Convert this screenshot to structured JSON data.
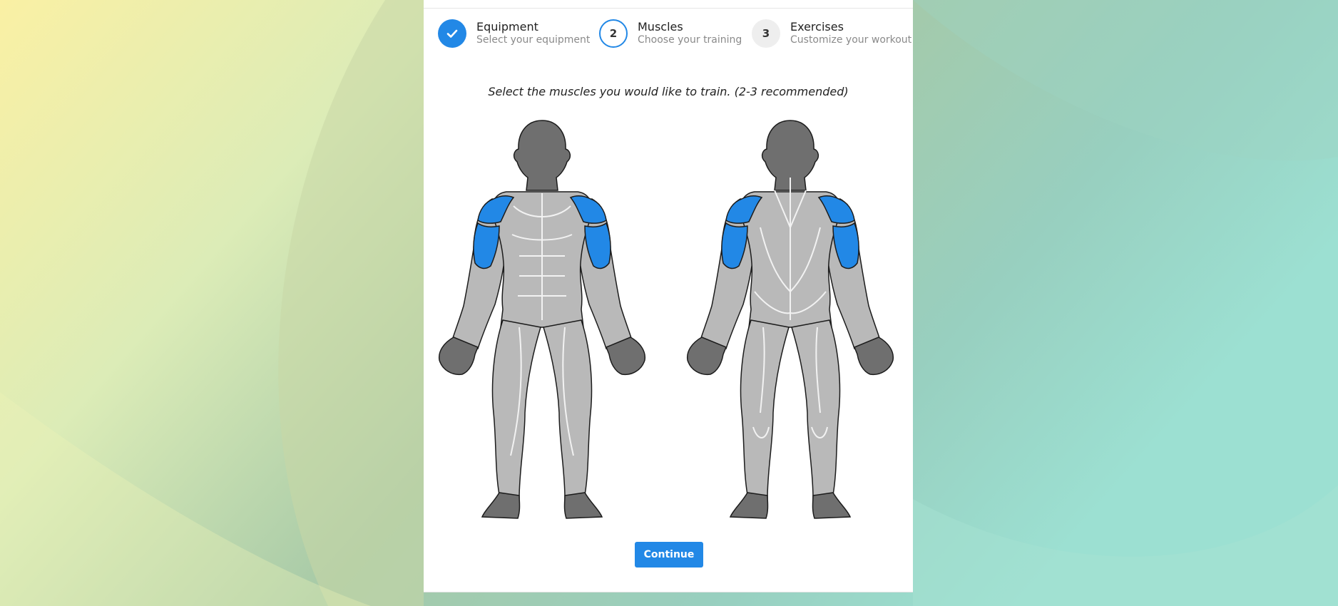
{
  "steps": [
    {
      "number": "",
      "title": "Equipment",
      "subtitle": "Select your equipment",
      "state": "done"
    },
    {
      "number": "2",
      "title": "Muscles",
      "subtitle": "Choose your training",
      "state": "active"
    },
    {
      "number": "3",
      "title": "Exercises",
      "subtitle": "Customize your workout",
      "state": "todo"
    }
  ],
  "instruction": "Select the muscles you would like to train. (2-3 recommended)",
  "selected_muscles": [
    "shoulders",
    "biceps",
    "triceps"
  ],
  "continue_label": "Continue",
  "colors": {
    "accent": "#2288e6",
    "muscle": "#b9b9b9",
    "muscle_selected": "#2288e6",
    "body_dark": "#6f6f6f"
  }
}
